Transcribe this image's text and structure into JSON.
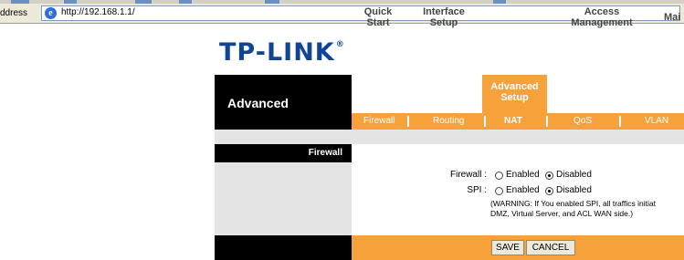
{
  "browser": {
    "address_label": "ddress",
    "url": "http://192.168.1.1/",
    "ie_icon": "ie-logo-icon"
  },
  "logo": {
    "text": "TP-LINK",
    "reg": "®"
  },
  "sidebar": {
    "title": "Advanced"
  },
  "tabs": [
    {
      "line1": "Quick",
      "line2": "Start"
    },
    {
      "line1": "Interface",
      "line2": "Setup"
    },
    {
      "line1": "Advanced",
      "line2": "Setup",
      "active": true
    },
    {
      "line1": "Access",
      "line2": "Management"
    },
    {
      "line1": "Mai",
      "line2": ""
    }
  ],
  "subtabs": [
    {
      "label": "Firewall"
    },
    {
      "label": "Routing"
    },
    {
      "label": "NAT",
      "active": true
    },
    {
      "label": "QoS"
    },
    {
      "label": "VLAN"
    }
  ],
  "section": {
    "title": "Firewall"
  },
  "form": {
    "firewall": {
      "label": "Firewall :",
      "enabled": "Enabled",
      "disabled": "Disabled",
      "selected": "Disabled"
    },
    "spi": {
      "label": "SPI :",
      "enabled": "Enabled",
      "disabled": "Disabled",
      "selected": "Disabled"
    },
    "warning_line1": "(WARNING: If You enabled SPI, all traffics initiat",
    "warning_line2": "DMZ, Virtual Server, and ACL WAN side.)"
  },
  "buttons": {
    "save": "SAVE",
    "cancel": "CANCEL"
  },
  "colors": {
    "orange": "#f7a13b",
    "black": "#000000",
    "grey": "#e4e4e4",
    "logo_blue": "#0f4594"
  }
}
